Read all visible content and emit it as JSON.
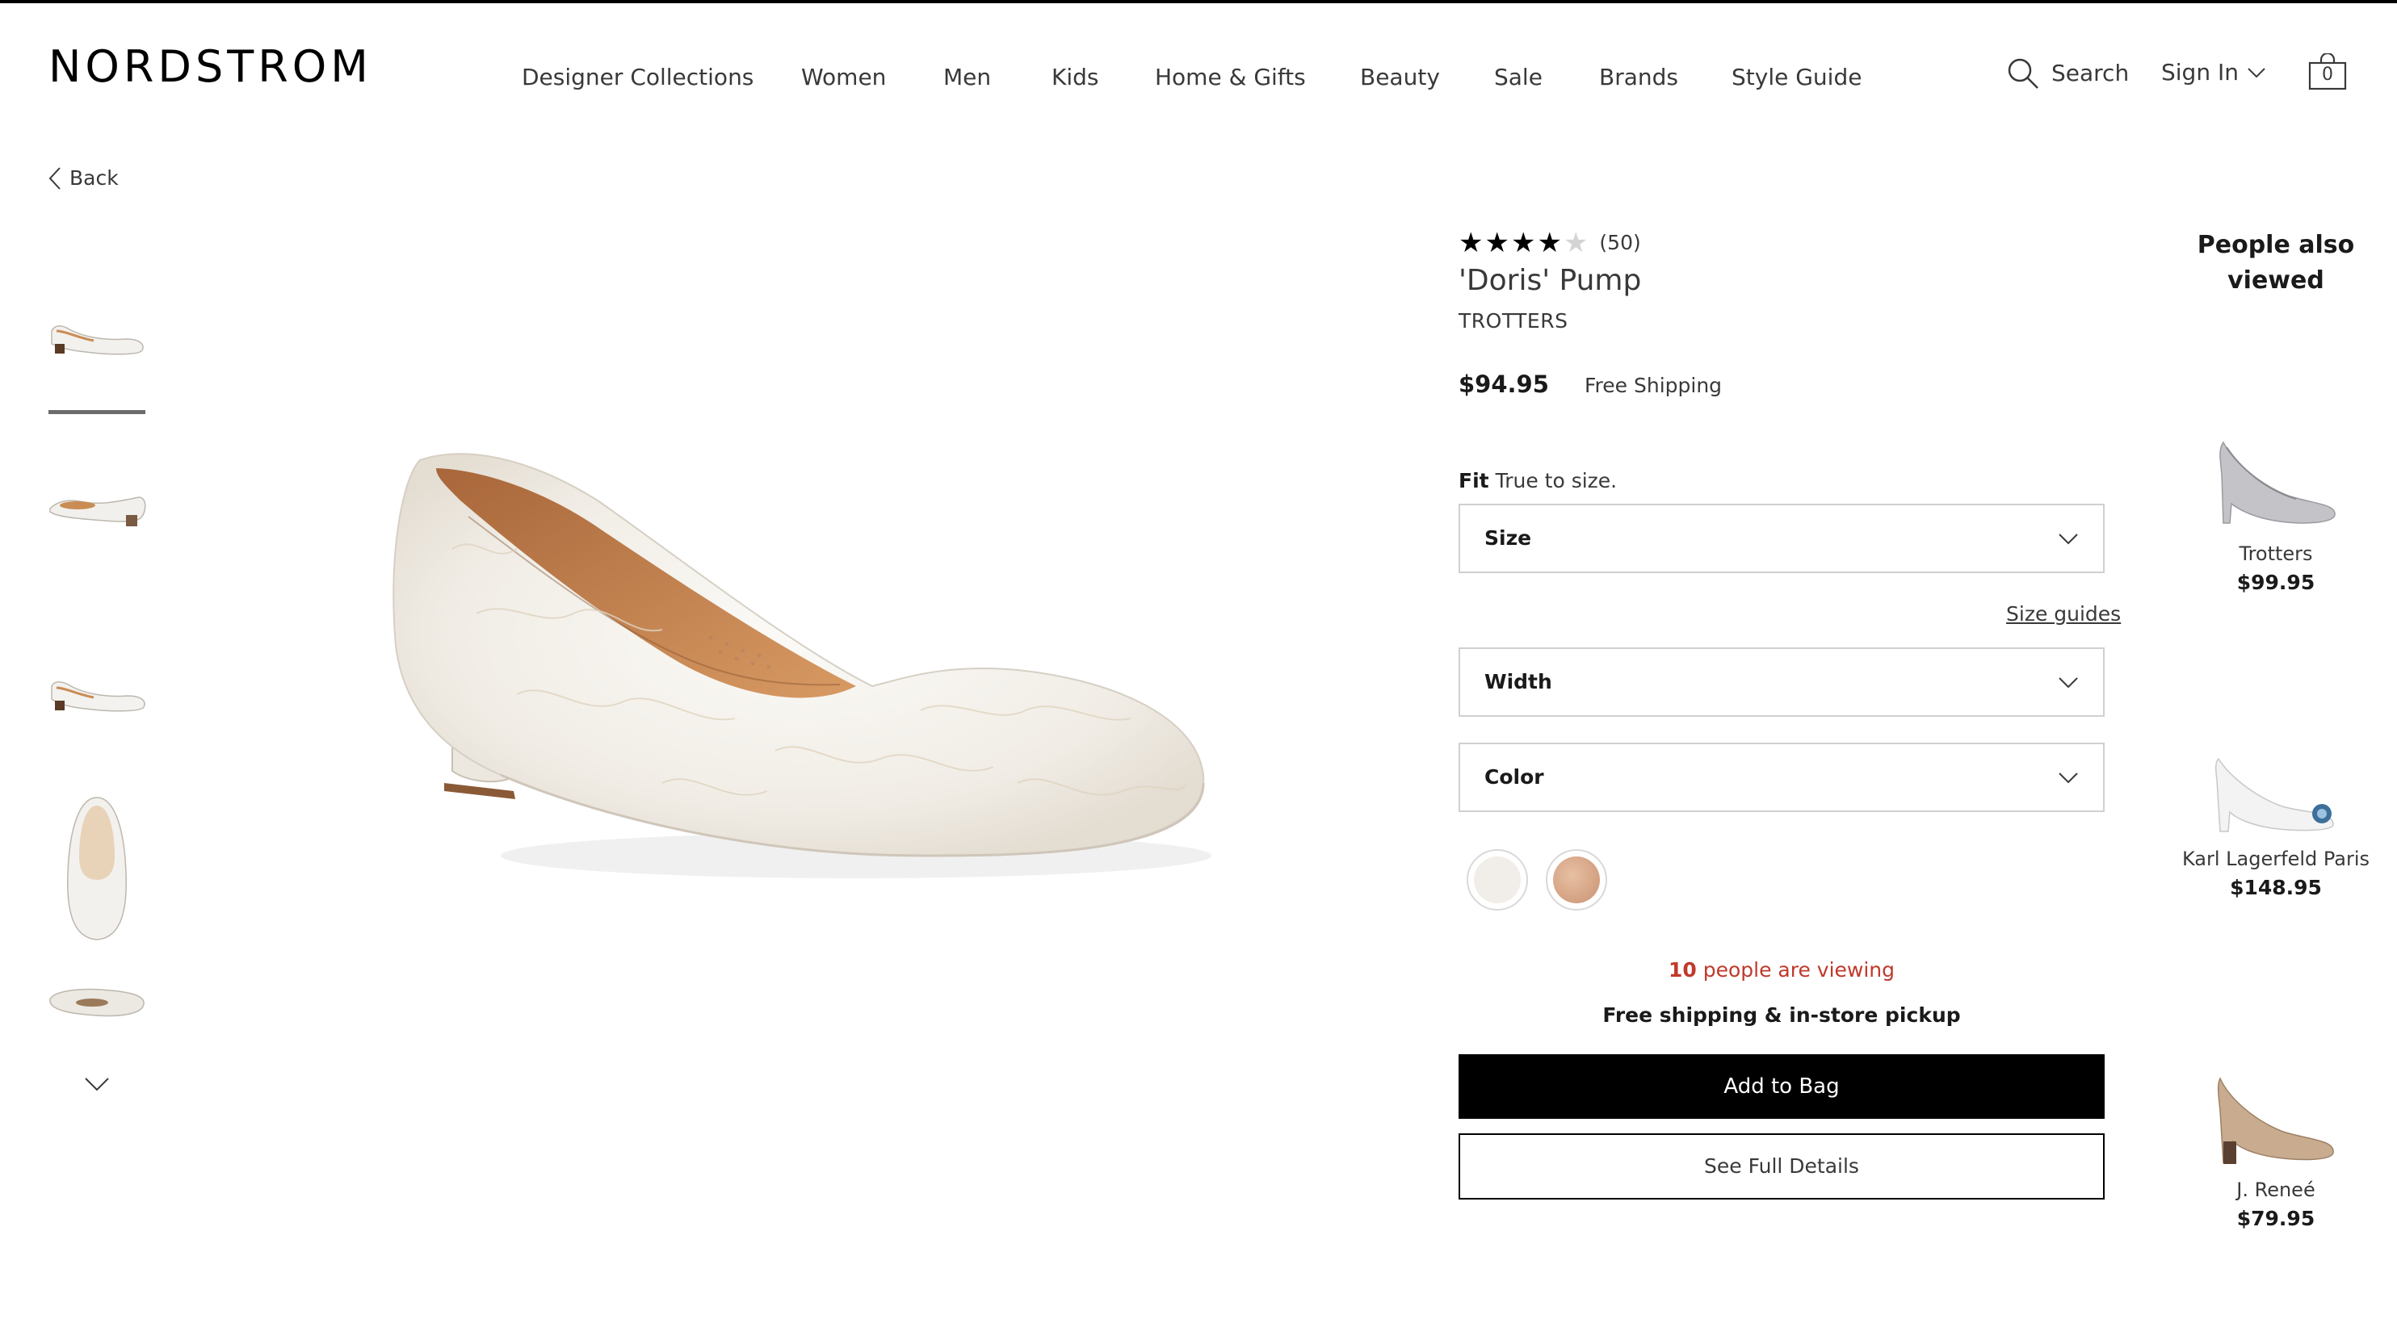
{
  "header": {
    "logo": "NORDSTROM",
    "nav": [
      "Designer Collections",
      "Women",
      "Men",
      "Kids",
      "Home & Gifts",
      "Beauty",
      "Sale",
      "Brands",
      "Style Guide"
    ],
    "search_label": "Search",
    "sign_in_label": "Sign In",
    "bag_count": "0"
  },
  "back_label": "Back",
  "gallery": {
    "thumbnail_count": 5,
    "active_index": 0,
    "icons": [
      "shoe-side-view",
      "shoe-angle-view",
      "shoe-side-view",
      "shoe-top-view",
      "shoe-sole-view"
    ]
  },
  "product": {
    "rating": 4,
    "rating_max": 5,
    "review_count": "(50)",
    "name": "'Doris' Pump",
    "brand": "TROTTERS",
    "price": "$94.95",
    "shipping": "Free Shipping",
    "fit_label": "Fit",
    "fit_value": "True to size.",
    "size_label": "Size",
    "size_guides_label": "Size guides",
    "width_label": "Width",
    "color_label": "Color",
    "swatches": [
      {
        "name": "white",
        "color": "#f1eee9"
      },
      {
        "name": "blush",
        "color": "#d9a98a"
      }
    ],
    "viewing_count": "10",
    "viewing_text": "people are viewing",
    "pickup_text": "Free shipping & in-store pickup",
    "add_to_bag_label": "Add to Bag",
    "full_details_label": "See Full Details"
  },
  "people_also_viewed": {
    "title": "People also viewed",
    "items": [
      {
        "brand": "Trotters",
        "price": "$99.95",
        "color": "#b9b9bd"
      },
      {
        "brand": "Karl Lagerfeld Paris",
        "price": "$148.95",
        "color": "#f2f2f2"
      },
      {
        "brand": "J. Reneé",
        "price": "$79.95",
        "color": "#c9ac8f"
      }
    ]
  }
}
